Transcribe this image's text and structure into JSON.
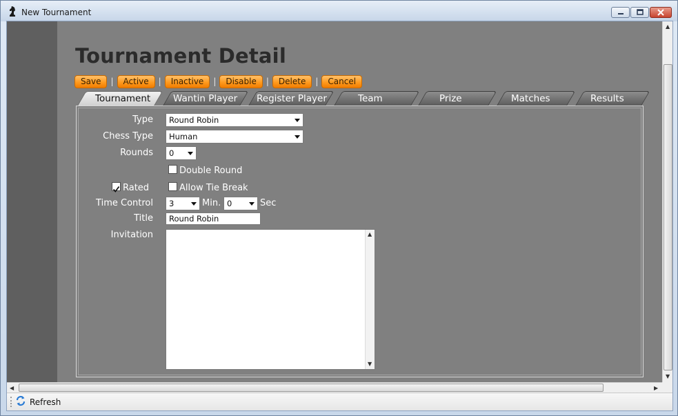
{
  "window": {
    "title": "New Tournament"
  },
  "page": {
    "title": "Tournament Detail"
  },
  "toolbar": {
    "buttons": [
      "Save",
      "Active",
      "Inactive",
      "Disable",
      "Delete",
      "Cancel"
    ],
    "separator": "|"
  },
  "tabs": [
    {
      "label": "Tournament",
      "active": true
    },
    {
      "label": "Wantin Player",
      "active": false
    },
    {
      "label": "Register Player",
      "active": false
    },
    {
      "label": "Team",
      "active": false
    },
    {
      "label": "Prize",
      "active": false
    },
    {
      "label": "Matches",
      "active": false
    },
    {
      "label": "Results",
      "active": false
    }
  ],
  "form": {
    "type_label": "Type",
    "type_value": "Round Robin",
    "chess_type_label": "Chess Type",
    "chess_type_value": "Human",
    "rounds_label": "Rounds",
    "rounds_value": "0",
    "double_round_label": "Double Round",
    "double_round_checked": false,
    "rated_label": "Rated",
    "rated_checked": true,
    "tie_break_label": "Allow Tie Break",
    "tie_break_checked": false,
    "time_control_label": "Time Control",
    "time_minutes_value": "3",
    "minutes_unit": "Min.",
    "time_seconds_value": "0",
    "seconds_unit": "Sec",
    "title_label": "Title",
    "title_value": "Round Robin",
    "invitation_label": "Invitation",
    "invitation_value": ""
  },
  "status": {
    "refresh_label": "Refresh"
  },
  "colors": {
    "accent_orange": "#ff9a1f",
    "content_gray": "#808080",
    "strip_gray": "#5f5f5f"
  }
}
